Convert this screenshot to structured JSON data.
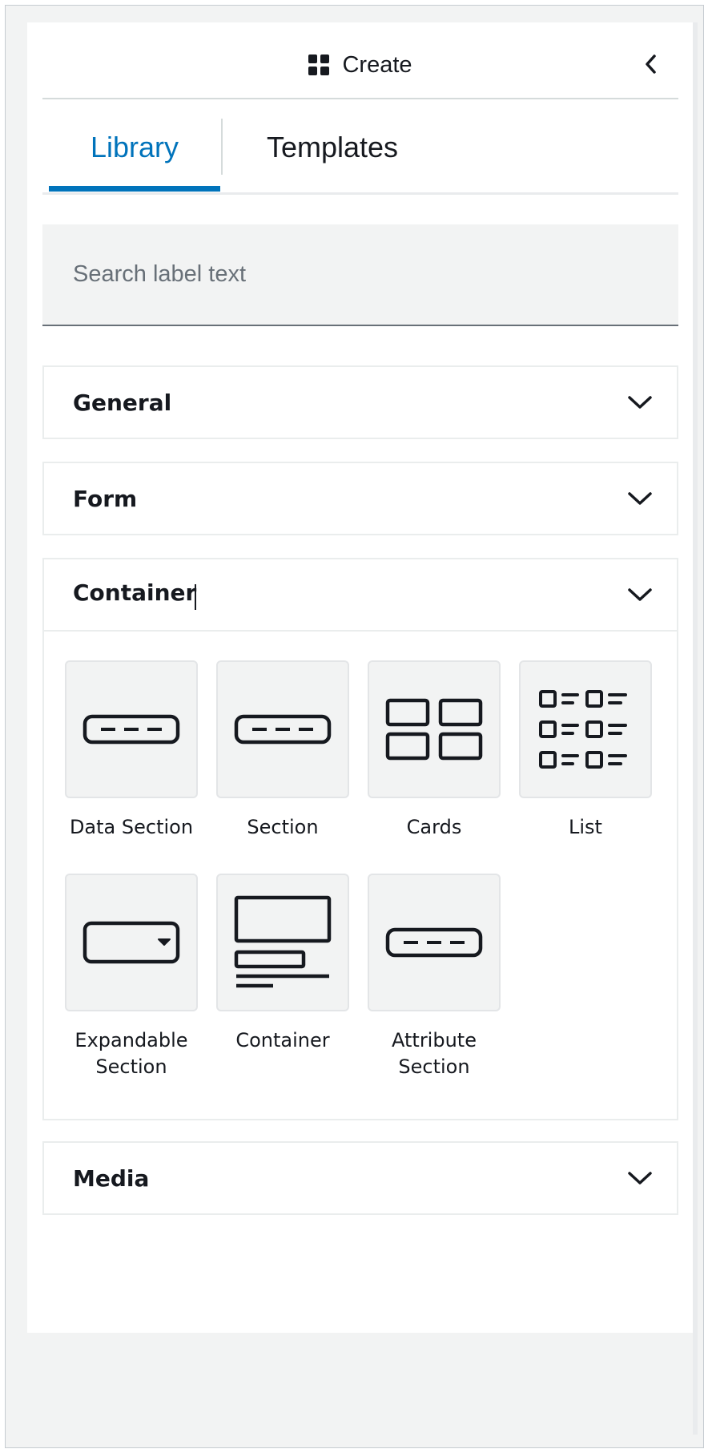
{
  "header": {
    "title": "Create",
    "title_icon": "grid-icon",
    "collapse_icon": "chevron-left-icon"
  },
  "tabs": [
    {
      "label": "Library",
      "active": true
    },
    {
      "label": "Templates",
      "active": false
    }
  ],
  "search": {
    "placeholder": "Search label text",
    "value": ""
  },
  "sections": {
    "general": {
      "title": "General",
      "expanded": false
    },
    "form": {
      "title": "Form",
      "expanded": false
    },
    "container": {
      "title": "Container",
      "expanded": true,
      "items": [
        {
          "label": "Data Section",
          "icon": "data-section-icon"
        },
        {
          "label": "Section",
          "icon": "section-icon"
        },
        {
          "label": "Cards",
          "icon": "cards-icon"
        },
        {
          "label": "List",
          "icon": "list-icon"
        },
        {
          "label": "Expandable\nSection",
          "icon": "expandable-section-icon"
        },
        {
          "label": "Container",
          "icon": "container-icon"
        },
        {
          "label": "Attribute\nSection",
          "icon": "attribute-section-icon"
        }
      ]
    },
    "media": {
      "title": "Media",
      "expanded": false
    }
  },
  "colors": {
    "accent": "#0073bb",
    "text": "#16191f",
    "tile_bg": "#f2f3f3",
    "border": "#eaeded"
  }
}
